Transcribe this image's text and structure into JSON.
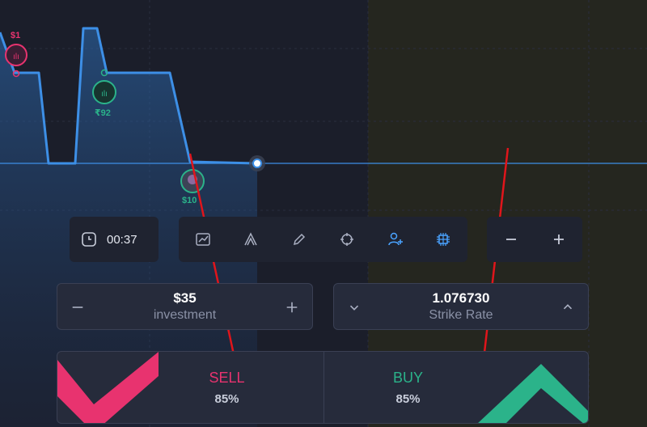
{
  "chart": {
    "markers": [
      {
        "amount": "$1",
        "color": "#e8336f"
      },
      {
        "amount": "₹92",
        "color": "#2bb38a"
      },
      {
        "amount": "$10",
        "color": "#2bb38a"
      }
    ]
  },
  "toolbar": {
    "timer": "00:37",
    "tools": [
      {
        "name": "chart-type-icon"
      },
      {
        "name": "indicators-icon"
      },
      {
        "name": "pencil-icon"
      },
      {
        "name": "crosshair-icon"
      },
      {
        "name": "user-add-icon"
      },
      {
        "name": "grid-icon"
      }
    ],
    "zoom": [
      {
        "name": "minus-icon"
      },
      {
        "name": "plus-icon"
      }
    ]
  },
  "investment": {
    "value": "$35",
    "label": "investment"
  },
  "strike": {
    "value": "1.076730",
    "label": "Strike Rate"
  },
  "sell": {
    "label": "SELL",
    "payout": "85%",
    "color": "#e8336f"
  },
  "buy": {
    "label": "BUY",
    "payout": "85%",
    "color": "#2bb38a"
  },
  "colors": {
    "accent": "#4aa3ff",
    "background": "#1b1e2a",
    "annotation": "#e0151b"
  }
}
